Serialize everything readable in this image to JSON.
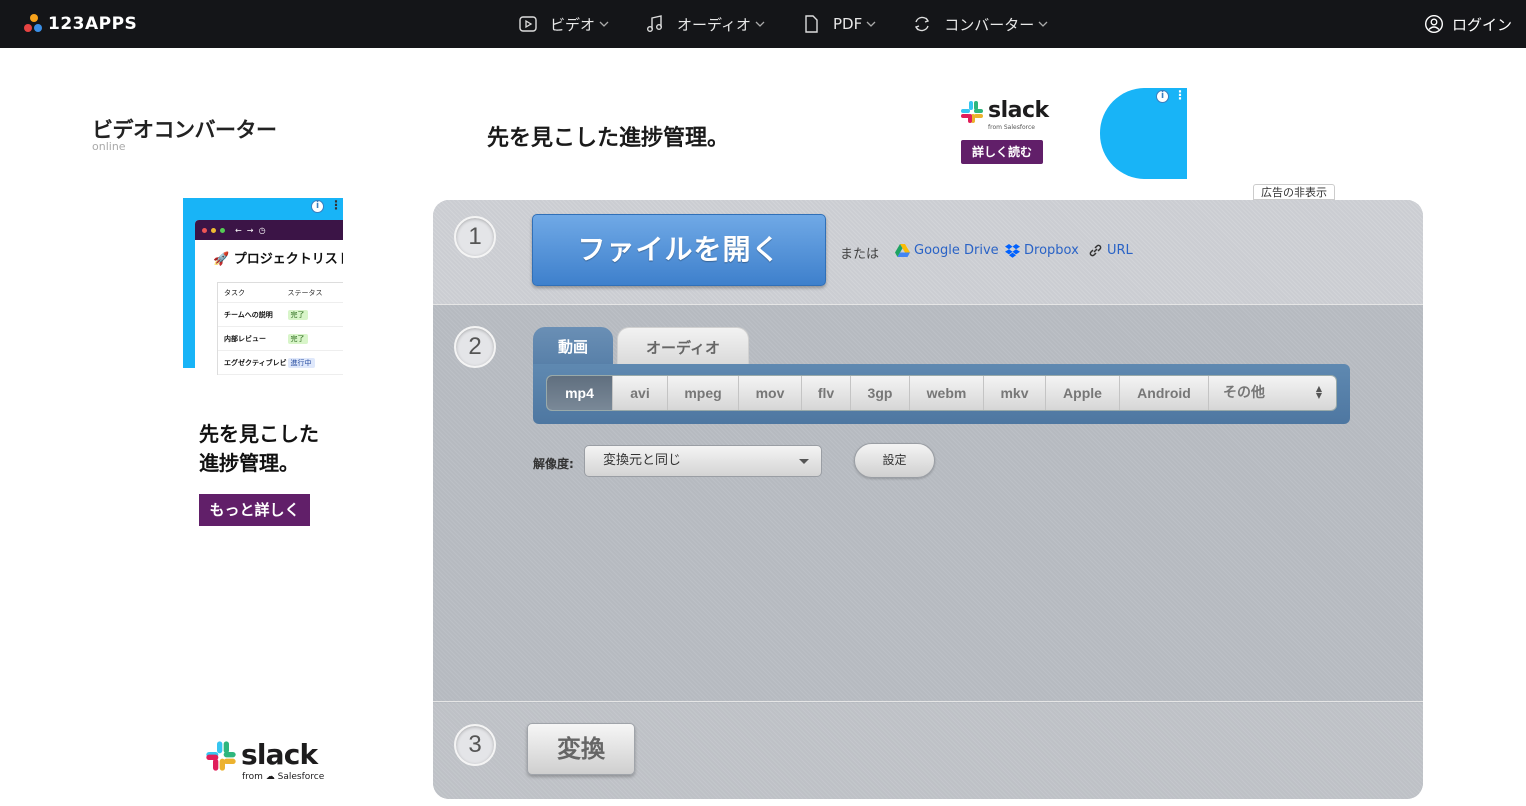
{
  "header": {
    "logo_text": "123APPS",
    "nav": [
      {
        "label": "ビデオ",
        "icon": "video-icon"
      },
      {
        "label": "オーディオ",
        "icon": "music-icon"
      },
      {
        "label": "PDF",
        "icon": "file-icon"
      },
      {
        "label": "コンバーター",
        "icon": "convert-icon"
      }
    ],
    "login_label": "ログイン"
  },
  "app": {
    "title": "ビデオコンバーター",
    "subtitle": "online"
  },
  "ads": {
    "top_headline": "先を見こした進捗管理。",
    "top_brand": "slack",
    "top_brand_sub": "from Salesforce",
    "top_cta": "詳しく読む",
    "hide_ads": "広告の非表示",
    "side_project_title": "🚀 プロジェクトリスト",
    "side_table_headers": [
      "タスク",
      "ステータス"
    ],
    "side_table_rows": [
      {
        "task": "チームへの説明",
        "status": "完了"
      },
      {
        "task": "内部レビュー",
        "status": "完了"
      },
      {
        "task": "エグゼクティブレビ",
        "status": "進行中"
      }
    ],
    "side_headline_1": "先を見こした",
    "side_headline_2": "進捗管理。",
    "side_cta": "もっと詳しく",
    "side_brand": "slack",
    "side_brand_sub": "from ☁ Salesforce"
  },
  "converter": {
    "steps": [
      "1",
      "2",
      "3"
    ],
    "open_file_label": "ファイルを開く",
    "or_label": "または",
    "sources": [
      {
        "label": "Google Drive",
        "icon": "google-drive-icon"
      },
      {
        "label": "Dropbox",
        "icon": "dropbox-icon"
      },
      {
        "label": "URL",
        "icon": "link-icon"
      }
    ],
    "tabs": [
      {
        "label": "動画",
        "active": true
      },
      {
        "label": "オーディオ",
        "active": false
      }
    ],
    "formats": [
      "mp4",
      "avi",
      "mpeg",
      "mov",
      "flv",
      "3gp",
      "webm",
      "mkv",
      "Apple",
      "Android"
    ],
    "selected_format": "mp4",
    "other_label": "その他",
    "resolution_label": "解像度:",
    "resolution_value": "変換元と同じ",
    "settings_label": "設定",
    "convert_label": "変換"
  }
}
